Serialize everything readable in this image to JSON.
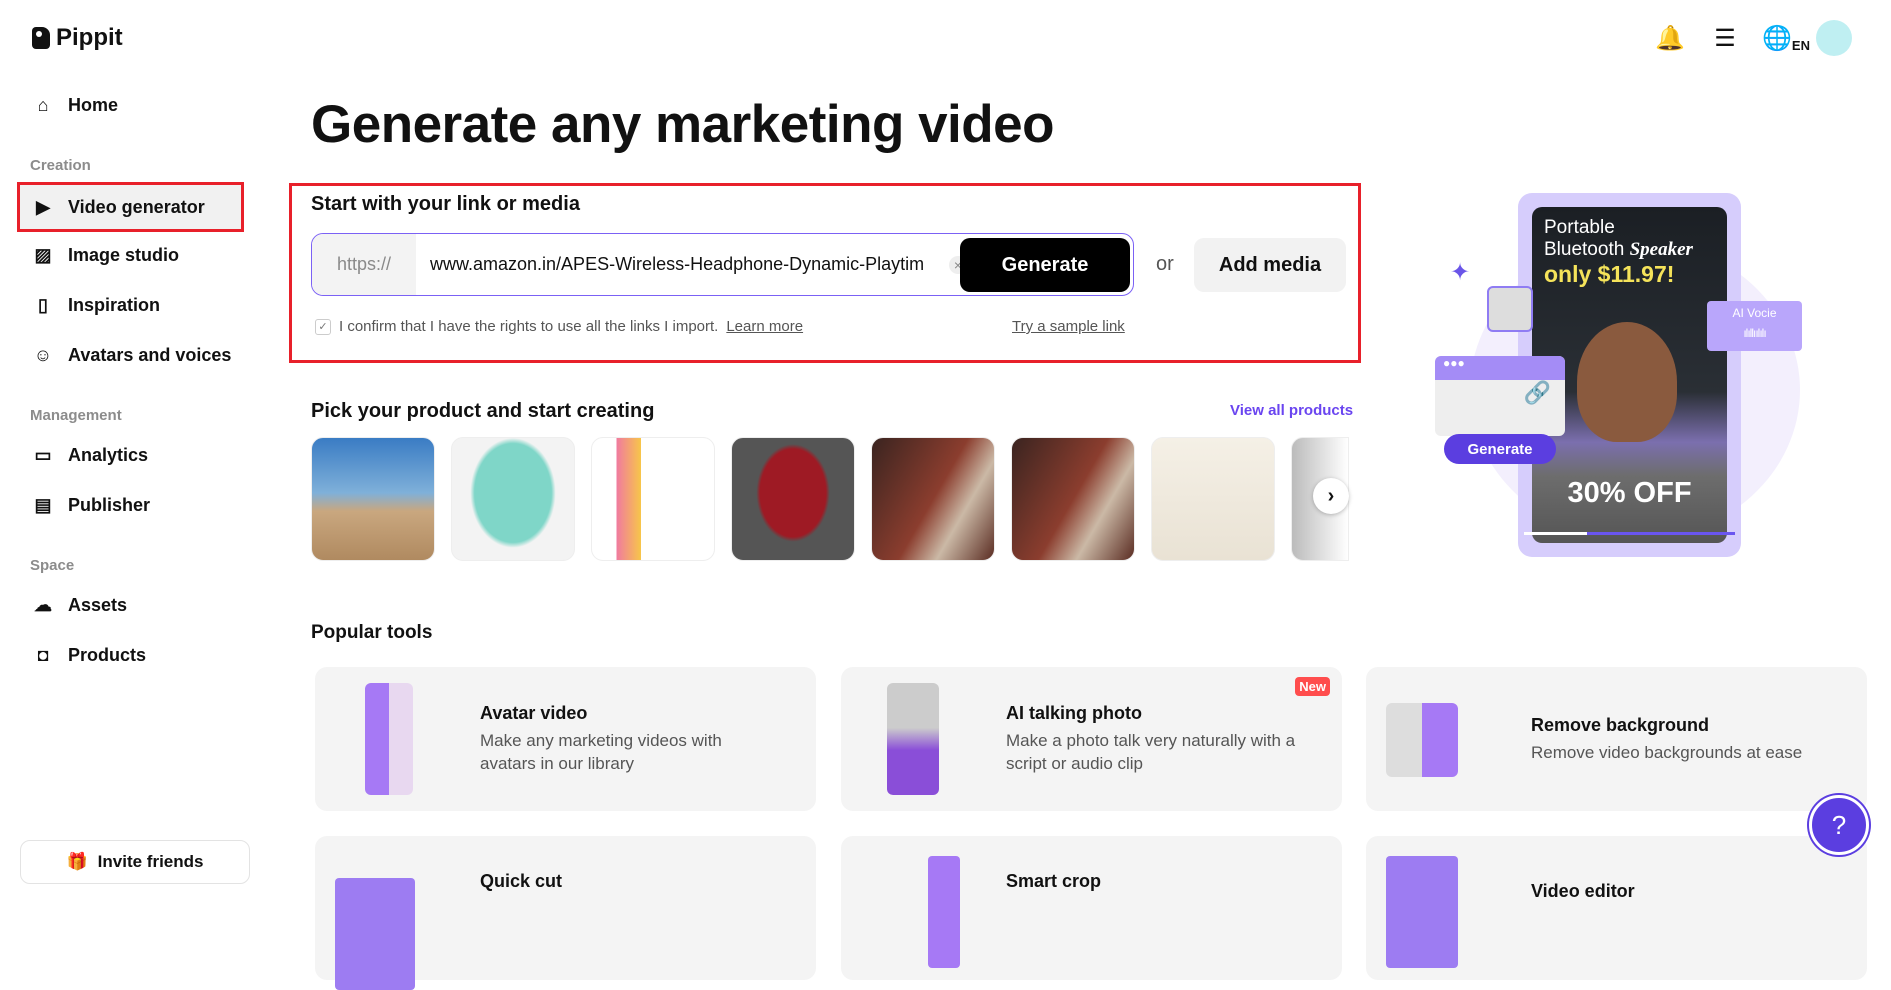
{
  "app": {
    "name": "Pippit"
  },
  "header": {
    "notifications": "bell-icon",
    "subscription": "layers-icon",
    "language": "EN"
  },
  "sidebar": {
    "home": "Home",
    "sections": [
      "Creation",
      "Management",
      "Space"
    ],
    "items": [
      {
        "label": "Video generator",
        "icon": "video-plus-icon"
      },
      {
        "label": "Image studio",
        "icon": "image-plus-icon"
      },
      {
        "label": "Inspiration",
        "icon": "inspiration-icon"
      },
      {
        "label": "Avatars and voices",
        "icon": "avatar-icon"
      },
      {
        "label": "Analytics",
        "icon": "chart-icon"
      },
      {
        "label": "Publisher",
        "icon": "calendar-icon"
      },
      {
        "label": "Assets",
        "icon": "cloud-icon"
      },
      {
        "label": "Products",
        "icon": "bag-icon"
      }
    ],
    "invite": "Invite friends"
  },
  "main": {
    "title": "Generate any marketing video",
    "link_section": {
      "heading": "Start with your link or media",
      "prefix": "https://",
      "url_value": "www.amazon.in/APES-Wireless-Headphone-Dynamic-Playtim",
      "clear": "×",
      "generate": "Generate",
      "or": "or",
      "add_media": "Add media",
      "confirm": "I confirm that I have the rights to use all the links I import.",
      "learn_more": "Learn more",
      "sample": "Try a sample link"
    },
    "products": {
      "heading": "Pick your product and start creating",
      "view_all": "View all products",
      "next": "›"
    },
    "tools": {
      "heading": "Popular tools",
      "items": [
        {
          "title": "Avatar video",
          "desc": "Make any marketing videos with avatars in our library"
        },
        {
          "title": "AI talking photo",
          "desc": "Make a photo talk very naturally with a script or audio clip",
          "badge": "New"
        },
        {
          "title": "Remove background",
          "desc": "Remove video backgrounds at ease"
        },
        {
          "title": "Quick cut",
          "desc": ""
        },
        {
          "title": "Smart crop",
          "desc": ""
        },
        {
          "title": "Video editor",
          "desc": ""
        }
      ]
    },
    "promo": {
      "line1": "Portable",
      "line2": "Bluetooth",
      "line2b": "Speaker",
      "price": "only $11.97!",
      "discount": "30% OFF",
      "voice": "AI Vocie",
      "generate": "Generate",
      "progress": 0.3
    }
  },
  "help": "?"
}
